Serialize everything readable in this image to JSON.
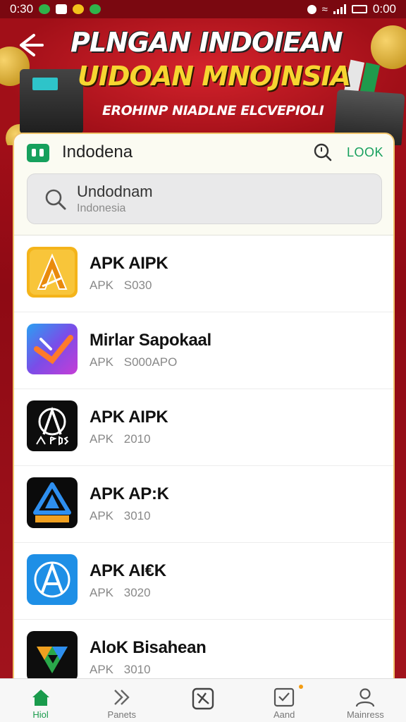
{
  "status_bar": {
    "time_left": "0:30",
    "time_right": "0:00"
  },
  "banner": {
    "title_line1": "PLNGAN INDOIEAN",
    "title_line2": "UIDOAN MNOJNSIA",
    "subtitle": "EROHINP NIADLNE ELCVEPIOLI"
  },
  "header": {
    "title": "Indodena",
    "look_label": "LOOK"
  },
  "search": {
    "value": "Undodnam",
    "placeholder": "Indonesia"
  },
  "apps": [
    {
      "name": "APK AIPK",
      "meta": "APK  S030",
      "icon": "apk-yellow-a-icon"
    },
    {
      "name": "Mirlar Sapokaal",
      "meta": "APK  S000APO",
      "icon": "apk-gradient-arrow-icon"
    },
    {
      "name": "APK AIPK",
      "meta": "APK  2010",
      "icon": "apk-black-apds-icon"
    },
    {
      "name": "APK AP:K",
      "meta": "APK  3010",
      "icon": "apk-black-blue-triangle-icon"
    },
    {
      "name": "APK AI€K",
      "meta": "APK  3020",
      "icon": "apk-blue-a-icon"
    },
    {
      "name": "AloK Bisahean",
      "meta": "APK  3010",
      "icon": "apk-black-triangle-icon"
    }
  ],
  "bottom_nav": [
    {
      "label": "Hiol",
      "icon": "home-icon"
    },
    {
      "label": "Panets",
      "icon": "double-chevron-icon"
    },
    {
      "label": "",
      "icon": "crossed-box-icon"
    },
    {
      "label": "Aand",
      "icon": "checkbox-icon"
    },
    {
      "label": "Mainress",
      "icon": "user-icon"
    }
  ],
  "colors": {
    "brand_green": "#17a05e",
    "banner_red": "#b3121c",
    "banner_yellow": "#f7d531"
  }
}
